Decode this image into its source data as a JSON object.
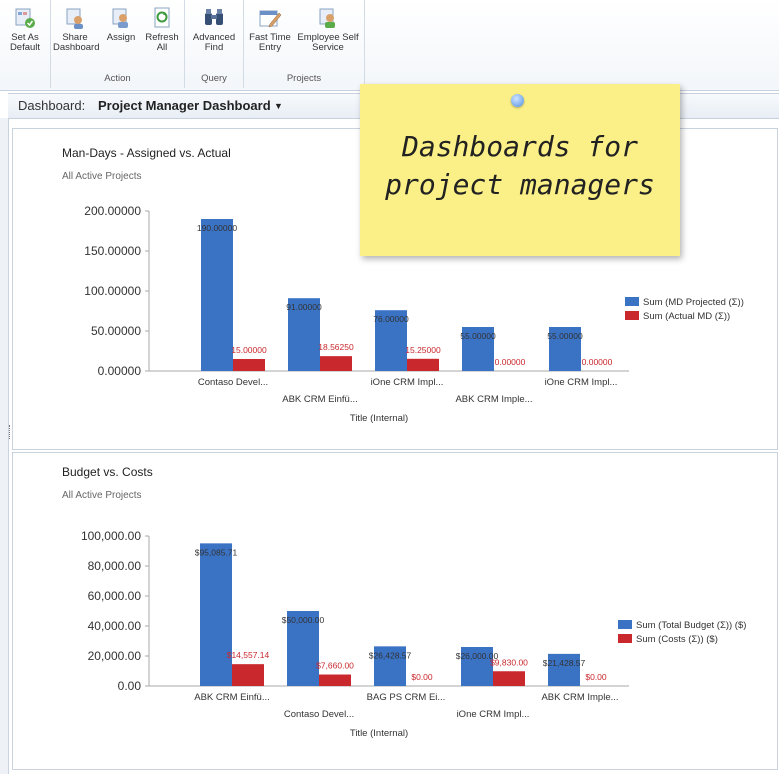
{
  "ribbon": {
    "buttons": [
      {
        "label1": "Set As",
        "label2": "Default"
      },
      {
        "label1": "Share",
        "label2": "Dashboard"
      },
      {
        "label1": "Assign",
        "label2": ""
      },
      {
        "label1": "Refresh",
        "label2": "All"
      },
      {
        "label1": "Advanced",
        "label2": "Find"
      },
      {
        "label1": "Fast Time",
        "label2": "Entry"
      },
      {
        "label1": "Employee Self",
        "label2": "Service"
      }
    ],
    "groups": [
      "Action",
      "Query",
      "Projects"
    ]
  },
  "dashboard": {
    "label": "Dashboard:",
    "name": "Project Manager Dashboard",
    "caret": "▼"
  },
  "sticky": {
    "line1": "Dashboards for",
    "line2": "project managers"
  },
  "colors": {
    "blue": "#3a72c4",
    "red": "#c9282d",
    "accent": "#c6d1de"
  },
  "chart_data": [
    {
      "type": "bar",
      "title": "Man-Days - Assigned vs. Actual",
      "subtitle": "All Active Projects",
      "xlabel": "Title (Internal)",
      "ylabel": "",
      "ylim": [
        0,
        200
      ],
      "yticks": [
        "0.00000",
        "50.00000",
        "100.00000",
        "150.00000",
        "200.00000"
      ],
      "categories": [
        "Contaso Devel...",
        "ABK CRM Einfü...",
        "iOne CRM Impl...",
        "ABK CRM Imple...",
        "iOne CRM Impl..."
      ],
      "series": [
        {
          "name": "Sum (MD Projected (Σ))",
          "values": [
            190,
            91,
            76,
            55,
            55
          ],
          "labels": [
            "190.00000",
            "91.00000",
            "76.00000",
            "55.00000",
            "55.00000"
          ]
        },
        {
          "name": "Sum (Actual MD (Σ))",
          "values": [
            15,
            18.5625,
            15.25,
            0,
            0
          ],
          "labels": [
            "15.00000",
            "18.56250",
            "15.25000",
            "0.00000",
            "0.00000"
          ]
        }
      ],
      "legend": "right"
    },
    {
      "type": "bar",
      "title": "Budget vs. Costs",
      "subtitle": "All Active Projects",
      "xlabel": "Title (Internal)",
      "ylabel": "",
      "ylim": [
        0,
        100000
      ],
      "yticks": [
        "0.00",
        "20,000.00",
        "40,000.00",
        "60,000.00",
        "80,000.00",
        "100,000.00"
      ],
      "categories": [
        "ABK CRM Einfü...",
        "Contaso Devel...",
        "BAG PS CRM Ei...",
        "iOne CRM Impl...",
        "ABK CRM Imple..."
      ],
      "series": [
        {
          "name": "Sum (Total Budget (Σ)) ($)",
          "values": [
            95085.71,
            50000,
            26428.57,
            26000,
            21428.57
          ],
          "labels": [
            "$95,085.71",
            "$50,000.00",
            "$26,428.57",
            "$26,000.00",
            "$21,428.57"
          ]
        },
        {
          "name": "Sum (Costs (Σ)) ($)",
          "values": [
            14557.14,
            7660,
            0,
            9830,
            0
          ],
          "labels": [
            "$14,557.14",
            "$7,660.00",
            "$0.00",
            "$9,830.00",
            "$0.00"
          ]
        }
      ],
      "legend": "right"
    }
  ]
}
